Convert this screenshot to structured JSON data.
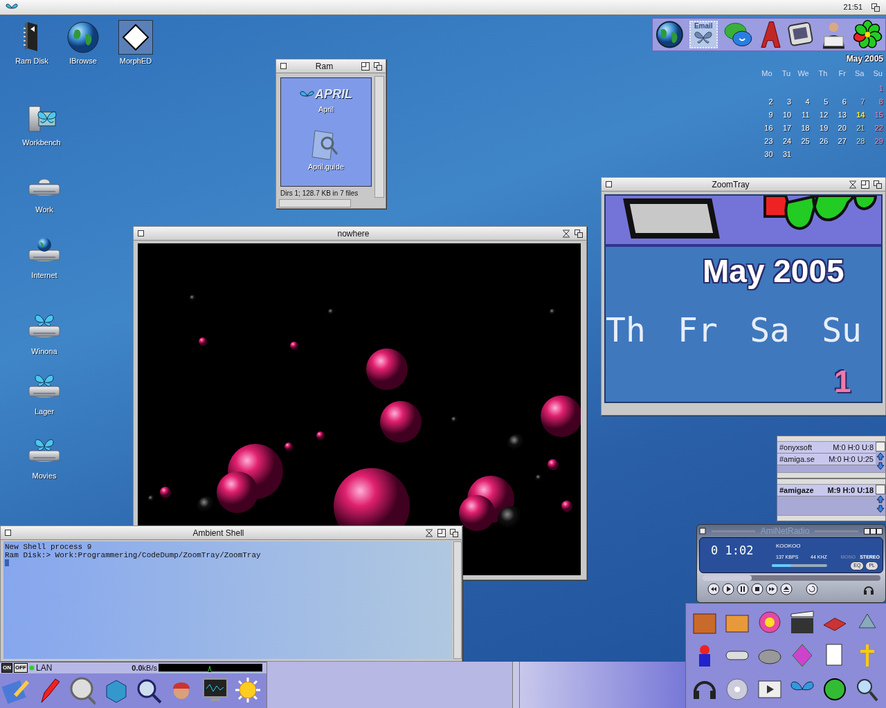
{
  "menubar": {
    "clock": "21:51"
  },
  "desktop_icons": [
    {
      "label": "Ram Disk",
      "kind": "ramdisk",
      "selected": false
    },
    {
      "label": "IBrowse",
      "kind": "globe",
      "selected": false
    },
    {
      "label": "MorphED",
      "kind": "document",
      "selected": true
    },
    {
      "label": "Workbench",
      "kind": "computer",
      "selected": false
    },
    {
      "label": "Work",
      "kind": "drive",
      "selected": false
    },
    {
      "label": "Internet",
      "kind": "drive-globe",
      "selected": false
    },
    {
      "label": "Winona",
      "kind": "drive-butterfly",
      "selected": false
    },
    {
      "label": "Lager",
      "kind": "drive-butterfly",
      "selected": false
    },
    {
      "label": "Movies",
      "kind": "drive-butterfly",
      "selected": false
    }
  ],
  "top_dock": {
    "stamp_label": "Email"
  },
  "calendar": {
    "title": "May 2005",
    "weekdays": [
      "Mo",
      "Tu",
      "We",
      "Th",
      "Fr",
      "Sa",
      "Su"
    ],
    "weeks": [
      [
        {
          "kind": "blank"
        },
        {
          "kind": "blank"
        },
        {
          "kind": "blank"
        },
        {
          "kind": "blank"
        },
        {
          "kind": "blank"
        },
        {
          "kind": "blank"
        },
        {
          "text": "1",
          "kind": "sunday"
        }
      ],
      [
        {
          "text": "2",
          "kind": "weekday"
        },
        {
          "text": "3",
          "kind": "weekday"
        },
        {
          "text": "4",
          "kind": "weekday"
        },
        {
          "text": "5",
          "kind": "weekday"
        },
        {
          "text": "6",
          "kind": "weekday"
        },
        {
          "text": "7",
          "kind": "saturday-past"
        },
        {
          "text": "8",
          "kind": "sunday"
        }
      ],
      [
        {
          "text": "9",
          "kind": "weekday"
        },
        {
          "text": "10",
          "kind": "weekday"
        },
        {
          "text": "11",
          "kind": "weekday"
        },
        {
          "text": "12",
          "kind": "weekday"
        },
        {
          "text": "13",
          "kind": "weekday"
        },
        {
          "text": "14",
          "kind": "today"
        },
        {
          "text": "15",
          "kind": "sunday"
        }
      ],
      [
        {
          "text": "16",
          "kind": "weekday"
        },
        {
          "text": "17",
          "kind": "weekday"
        },
        {
          "text": "18",
          "kind": "weekday"
        },
        {
          "text": "19",
          "kind": "weekday"
        },
        {
          "text": "20",
          "kind": "weekday"
        },
        {
          "text": "21",
          "kind": "saturday"
        },
        {
          "text": "22",
          "kind": "sunday"
        }
      ],
      [
        {
          "text": "23",
          "kind": "weekday"
        },
        {
          "text": "24",
          "kind": "weekday"
        },
        {
          "text": "25",
          "kind": "weekday"
        },
        {
          "text": "26",
          "kind": "weekday"
        },
        {
          "text": "27",
          "kind": "weekday"
        },
        {
          "text": "28",
          "kind": "saturday"
        },
        {
          "text": "29",
          "kind": "sunday"
        }
      ],
      [
        {
          "text": "30",
          "kind": "weekday"
        },
        {
          "text": "31",
          "kind": "weekday"
        },
        {
          "kind": "blank"
        },
        {
          "kind": "blank"
        },
        {
          "kind": "blank"
        },
        {
          "kind": "blank"
        },
        {
          "kind": "blank"
        }
      ]
    ]
  },
  "ram_window": {
    "title": "Ram",
    "icons": [
      {
        "label": "April",
        "kind": "logo",
        "logo_text": "APRIL"
      },
      {
        "label": "April.guide",
        "kind": "guide"
      }
    ],
    "status": "Dirs 1; 128.7 KB in 7 files"
  },
  "nowhere_window": {
    "title": "nowhere"
  },
  "zoomtray_window": {
    "title": "ZoomTray",
    "title_text": "May 2005",
    "weekdays": [
      "Th",
      "Fr",
      "Sa",
      "Su"
    ],
    "day": "1"
  },
  "irc_panels": [
    {
      "channels": [
        {
          "name": "#onyxsoft",
          "stats": "M:0 H:0 U:8",
          "active": false
        },
        {
          "name": "#amiga.se",
          "stats": "M:0 H:0 U:25",
          "active": false
        }
      ]
    },
    {
      "channels": [
        {
          "name": "#amigaze",
          "stats": "M:9 H:0 U:18",
          "active": true
        }
      ]
    }
  ],
  "radio": {
    "title": "AmiNetRadio",
    "time": "0 1:02",
    "track": "KOOKOO",
    "bitrate": "137 KBPS",
    "frequency": "44 KHZ",
    "modes": [
      {
        "label": "MONO",
        "on": false
      },
      {
        "label": "STEREO",
        "on": true
      }
    ],
    "volume": {
      "level": 0.35
    },
    "seek": {
      "level": 0.28
    },
    "buttons": [
      "EQ",
      "PL"
    ]
  },
  "shell_window": {
    "title": "Ambient Shell",
    "lines": [
      "New Shell process 9",
      "Ram Disk:> Work:Programmering/CodeDump/ZoomTray/ZoomTray"
    ]
  },
  "netmon": {
    "on_label": "ON",
    "off_label": "OFF",
    "interface": "LAN",
    "rate": "0.0",
    "unit": "kB/s"
  }
}
